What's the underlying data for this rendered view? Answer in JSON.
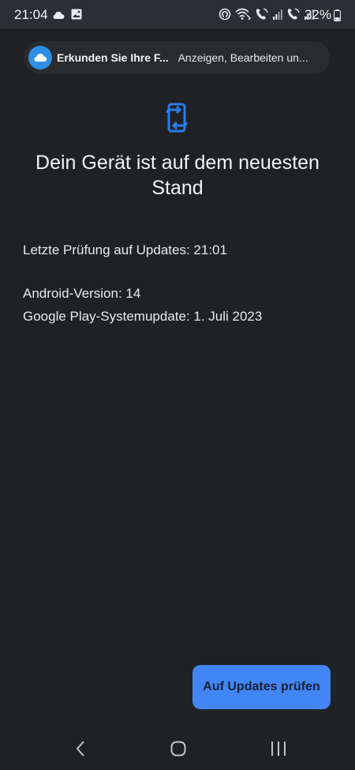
{
  "status_bar": {
    "time": "21:04",
    "battery_percent": "32%",
    "left_icons": [
      "cloud-icon",
      "image-icon"
    ],
    "right_icons": [
      "nfc-icon",
      "wifi-calling-icon",
      "volte-call-icon",
      "signal-icon",
      "volte-call-icon-2",
      "signal-icon-2",
      "battery-icon"
    ]
  },
  "notification": {
    "app_icon": "cloud-icon",
    "title": "Erkunden Sie Ihre F...",
    "text": "Anzeigen, Bearbeiten un..."
  },
  "main": {
    "icon": "phone-update-icon",
    "headline": "Dein Gerät ist auf dem neuesten Stand",
    "last_check": "Letzte Prüfung auf Updates: 21:01",
    "android_version": "Android-Version: 14",
    "play_system_update": "Google Play-Systemupdate: 1. Juli 2023"
  },
  "button": {
    "label": "Auf Updates prüfen"
  },
  "nav_bar": {
    "buttons": [
      "back-icon",
      "home-icon",
      "recents-icon"
    ]
  },
  "colors": {
    "background": "#202124",
    "accent": "#4285f4",
    "icon_blue": "#2b7de9"
  }
}
